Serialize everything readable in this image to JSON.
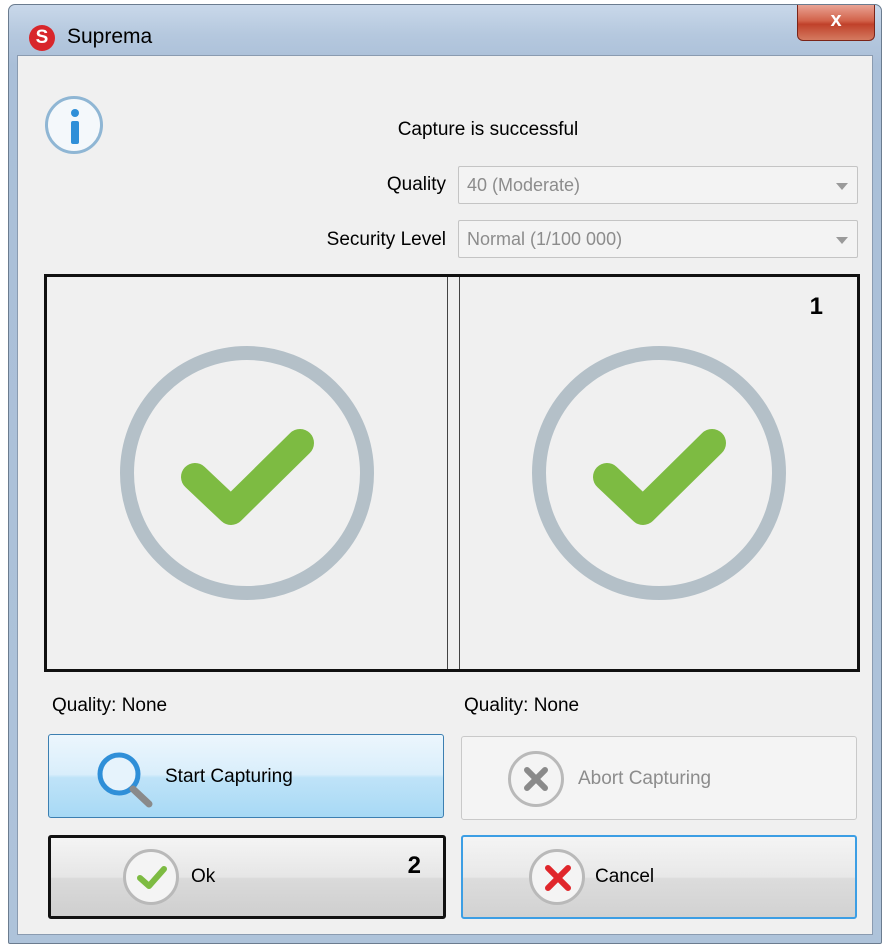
{
  "window": {
    "title": "Suprema",
    "app_icon_letter": "S",
    "close_symbol": "x"
  },
  "dialog": {
    "status_message": "Capture is successful",
    "quality_label": "Quality",
    "quality_value": "40 (Moderate)",
    "security_label": "Security Level",
    "security_value": "Normal (1/100 000)"
  },
  "panels": {
    "left": {
      "quality_text": "Quality: None",
      "state_icon": "check-circle-icon"
    },
    "right": {
      "quality_text": "Quality: None",
      "state_icon": "check-circle-icon",
      "badge": "1"
    }
  },
  "buttons": {
    "start_label": "Start Capturing",
    "abort_label": "Abort Capturing",
    "ok_label": "Ok",
    "ok_badge": "2",
    "cancel_label": "Cancel"
  },
  "colors": {
    "check_green": "#7dbb42",
    "ring_gray": "#b4c0c8",
    "info_blue": "#2f8fd8",
    "cancel_red": "#e0262b",
    "start_button_blue": "#bfe3f8"
  }
}
